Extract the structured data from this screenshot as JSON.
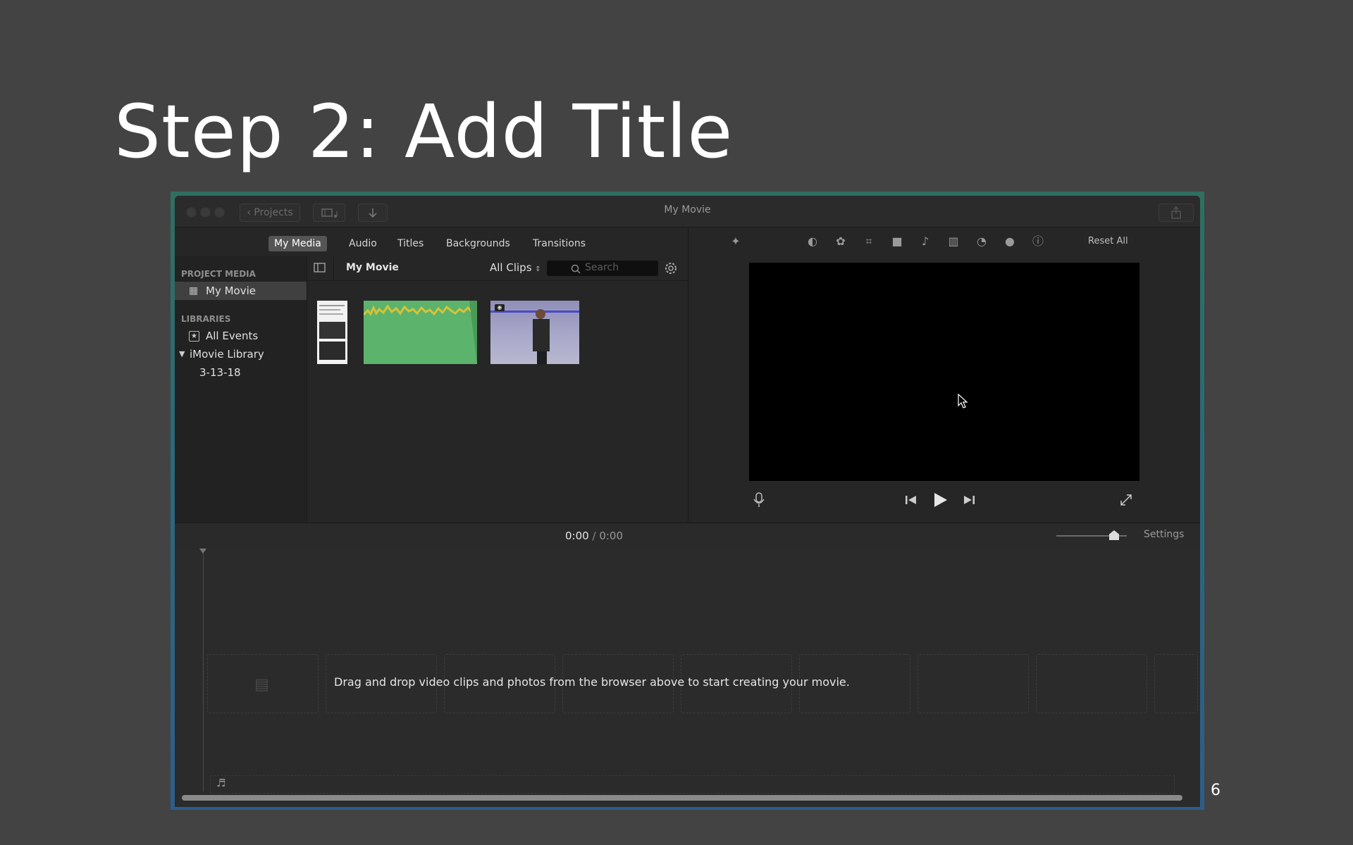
{
  "slide": {
    "title": "Step 2: Add Title",
    "page_number": "6"
  },
  "window": {
    "title": "My Movie",
    "projects_button": "Projects"
  },
  "browser_tabs": [
    {
      "label": "My Media",
      "active": true
    },
    {
      "label": "Audio",
      "active": false
    },
    {
      "label": "Titles",
      "active": false
    },
    {
      "label": "Backgrounds",
      "active": false
    },
    {
      "label": "Transitions",
      "active": false
    }
  ],
  "sidebar": {
    "project_media_heading": "PROJECT MEDIA",
    "project_item": "My Movie",
    "libraries_heading": "LIBRARIES",
    "all_events": "All Events",
    "library": "iMovie Library",
    "event": "3-13-18"
  },
  "media_browser": {
    "title": "My Movie",
    "filter": "All Clips",
    "search_placeholder": "Search"
  },
  "viewer": {
    "reset_all": "Reset All"
  },
  "timeline": {
    "current_time": "0:00",
    "separator": "/",
    "total_time": "0:00",
    "settings": "Settings",
    "zoom_level": 0.82,
    "empty_message": "Drag and drop video clips and photos from the browser above to start creating your movie."
  },
  "colors": {
    "slide_bg": "#434343",
    "active_tab": "#555555",
    "audio_clip": "#5cb36b",
    "waveform": "#d8c23a"
  }
}
